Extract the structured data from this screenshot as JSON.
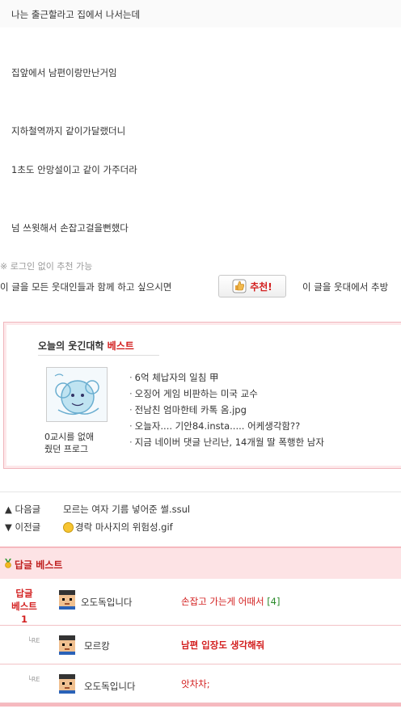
{
  "post": {
    "lines": [
      "나는 출근할라고 집에서 나서는데",
      "집앞에서 남편이랑만난거임",
      "지하철역까지 같이가달랬더니",
      "1초도 안망설이고 같이 가주더라",
      "넘 쓰윗해서 손잡고걸을뻔했다"
    ]
  },
  "recommend": {
    "note": "※ 로그인 없이 추천 가능",
    "text_before": "이 글을 모든 웃대인들과 함께 하고 싶으시면",
    "button_label": "추천!",
    "text_after": "이 글을 웃대에서 추방"
  },
  "best": {
    "title": "오늘의 웃긴대학",
    "title_highlight": "베스트",
    "thumb_caption_line1": "0교시를 없애",
    "thumb_caption_line2": "줬던 프로그",
    "items": [
      "6억 체납자의 일침 甲",
      "오징어 게임 비판하는 미국 교수",
      "전남친 엄마한테 카톡 옴.jpg",
      "오늘자.... 기안84.insta..... 어케생각함??",
      "지금 네이버 댓글 난리난, 14개월 딸 폭행한 남자"
    ]
  },
  "nav": {
    "next_label": "▲ 다음글",
    "next_title": "모르는 여자 기름 넣어준 썰.ssul",
    "prev_label": "▼ 이전글",
    "prev_title": "경락 마사지의 위험성.gif"
  },
  "replies": {
    "header": "답글 베스트",
    "best_label_line1": "답글",
    "best_label_line2": "베스트1",
    "re_marker": "└RE",
    "items": [
      {
        "nick": "오도독입니다",
        "text": "손잡고 가는게 어때서",
        "count": "[4]"
      },
      {
        "nick": "모르캉",
        "text": "남편 입장도 생각해줘"
      },
      {
        "nick": "오도독입니다",
        "text": "앗차차;"
      }
    ]
  },
  "colors": {
    "accent_red": "#d32020",
    "reply_header_bg": "#fde3e5",
    "border_pink": "#f6b9bf",
    "count_green": "#2a8a2a"
  },
  "icons": [
    "thumbs-up-icon",
    "smiley-icon",
    "medal-icon",
    "avatar-icon",
    "reply-arrow-icon"
  ]
}
